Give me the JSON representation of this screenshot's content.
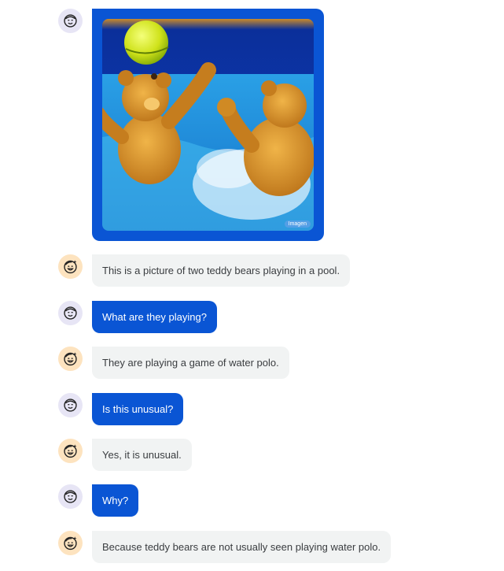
{
  "colors": {
    "user_bubble": "#0a55d4",
    "bot_bubble": "#f1f3f3",
    "user_avatar_bg": "#e7e5f5",
    "bot_avatar_bg": "#fde3bf"
  },
  "image_message": {
    "icon": "user-avatar-icon",
    "badge": "Imagen"
  },
  "messages": [
    {
      "role": "bot",
      "icon": "bot-avatar-icon",
      "text": "This is a picture of two teddy bears playing in a pool."
    },
    {
      "role": "user",
      "icon": "user-avatar-icon",
      "text": "What are they playing?"
    },
    {
      "role": "bot",
      "icon": "bot-avatar-icon",
      "text": "They are playing a game of water polo."
    },
    {
      "role": "user",
      "icon": "user-avatar-icon",
      "text": "Is this unusual?"
    },
    {
      "role": "bot",
      "icon": "bot-avatar-icon",
      "text": "Yes, it is unusual."
    },
    {
      "role": "user",
      "icon": "user-avatar-icon",
      "text": "Why?"
    },
    {
      "role": "bot",
      "icon": "bot-avatar-icon",
      "text": "Because teddy bears are not usually seen playing water polo."
    }
  ]
}
